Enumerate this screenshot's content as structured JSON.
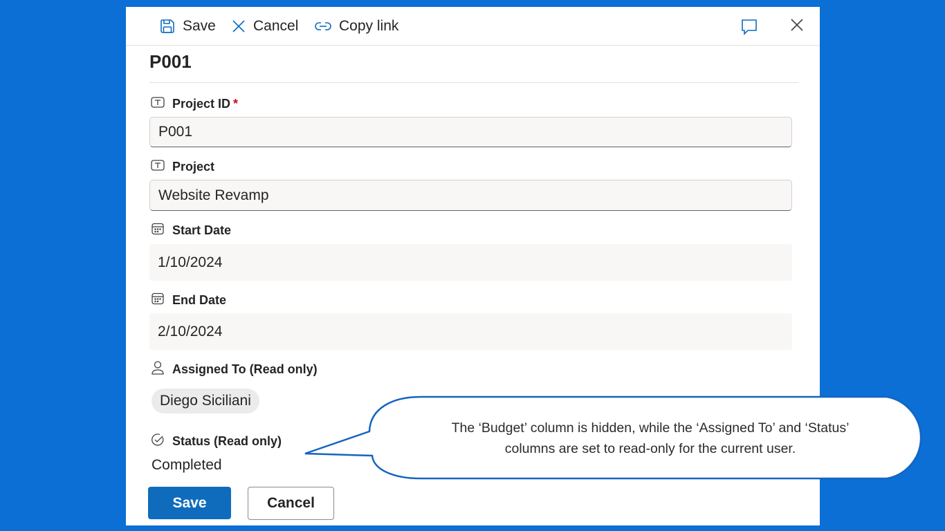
{
  "toolbar": {
    "save_label": "Save",
    "cancel_label": "Cancel",
    "copy_link_label": "Copy link"
  },
  "record": {
    "title": "P001"
  },
  "fields": {
    "project_id": {
      "label": "Project ID",
      "required_mark": "*",
      "value": "P001"
    },
    "project": {
      "label": "Project",
      "value": "Website Revamp"
    },
    "start_date": {
      "label": "Start Date",
      "value": "1/10/2024"
    },
    "end_date": {
      "label": "End Date",
      "value": "2/10/2024"
    },
    "assigned_to": {
      "label": "Assigned To (Read only)",
      "value": "Diego Siciliani"
    },
    "status": {
      "label": "Status (Read only)",
      "value": "Completed"
    }
  },
  "footer": {
    "save_label": "Save",
    "cancel_label": "Cancel"
  },
  "callout": {
    "line1": "The ‘Budget’ column is hidden, while the ‘Assigned To’ and ‘Status’",
    "line2": "columns are set to read-only for the current user."
  },
  "icons": {
    "save": "save-icon",
    "cancel": "close-x-icon",
    "copy_link": "link-icon",
    "comment": "comment-icon",
    "close": "close-icon",
    "text_field": "text-field-icon",
    "calendar": "calendar-icon",
    "person": "person-icon",
    "status": "check-circle-icon"
  },
  "colors": {
    "background": "#0b6fd6",
    "primary": "#0f6cbd",
    "accent_icon": "#0f6cbd",
    "required": "#c50f1f",
    "callout_border": "#1565c0"
  }
}
